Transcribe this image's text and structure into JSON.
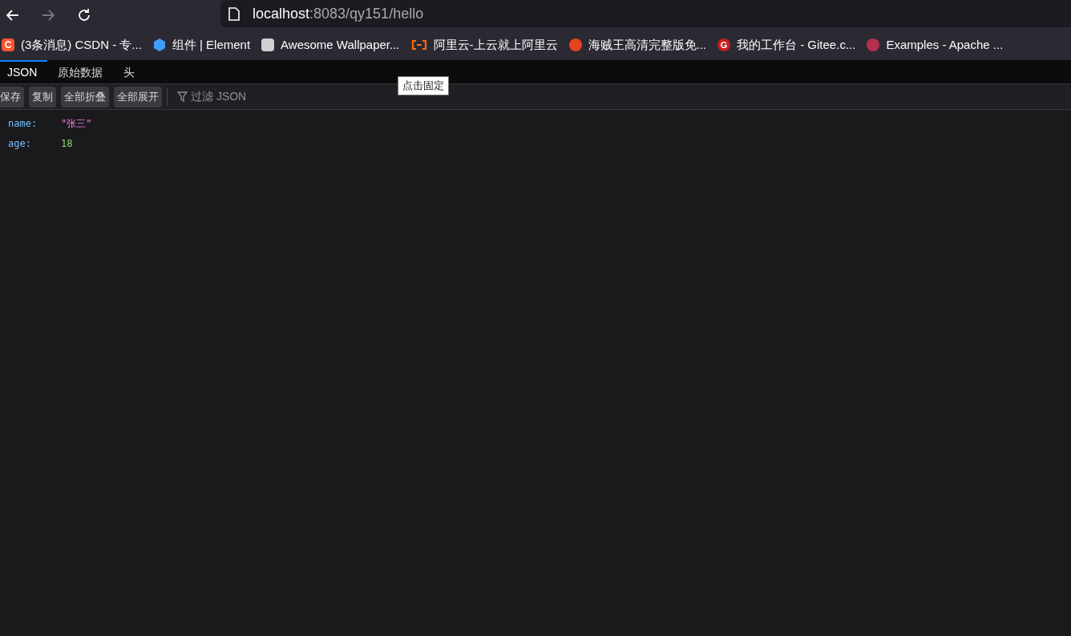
{
  "address_bar": {
    "host": "localhost",
    "path": ":8083/qy151/hello"
  },
  "bookmarks": [
    {
      "label": "(3条消息) CSDN - 专...",
      "logo": "C",
      "kind": "square",
      "color": "#fc5531"
    },
    {
      "label": "组件 | Element",
      "kind": "hexagon",
      "color": "#409eff"
    },
    {
      "label": "Awesome Wallpaper...",
      "kind": "square",
      "color": "#d0d0d0"
    },
    {
      "label": "阿里云-上云就上阿里云",
      "kind": "bracket",
      "color": "#ff6a00"
    },
    {
      "label": "海贼王高清完整版免...",
      "kind": "circle",
      "color": "#e8431c"
    },
    {
      "label": "我的工作台 - Gitee.c...",
      "logo": "G",
      "kind": "circle",
      "color": "#c71d23"
    },
    {
      "label": "Examples - Apache ...",
      "kind": "circle",
      "color": "#b5304f"
    }
  ],
  "tabs": [
    {
      "label": "JSON",
      "selected": true
    },
    {
      "label": "原始数据",
      "selected": false
    },
    {
      "label": "头",
      "selected": false
    }
  ],
  "toolbar": {
    "buttons": [
      "保存",
      "复制",
      "全部折叠",
      "全部展开"
    ],
    "filter": {
      "placeholder": "过滤 JSON"
    }
  },
  "tooltip": "点击固定",
  "json_rows": [
    {
      "key": "name:",
      "value": "\"张三\"",
      "kind": "string"
    },
    {
      "key": "age:",
      "value": "18",
      "kind": "number"
    }
  ]
}
